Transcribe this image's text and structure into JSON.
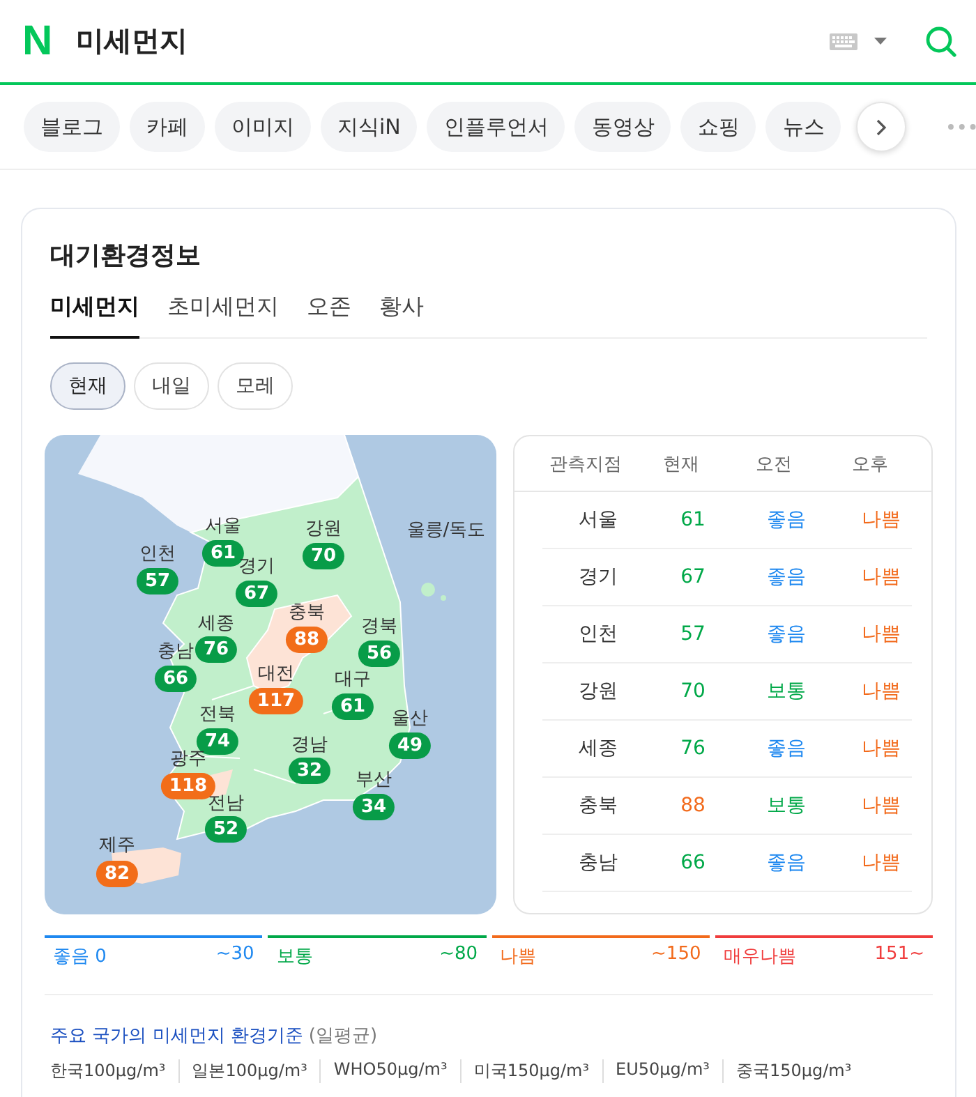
{
  "header": {
    "logo": "N",
    "query": "미세먼지"
  },
  "categories": [
    {
      "label": "블로그"
    },
    {
      "label": "카페"
    },
    {
      "label": "이미지"
    },
    {
      "label": "지식iN"
    },
    {
      "label": "인플루언서"
    },
    {
      "label": "동영상"
    },
    {
      "label": "쇼핑"
    },
    {
      "label": "뉴스"
    }
  ],
  "card": {
    "title": "대기환경정보",
    "tabs": [
      {
        "label": "미세먼지",
        "selected": true
      },
      {
        "label": "초미세먼지",
        "selected": false
      },
      {
        "label": "오존",
        "selected": false
      },
      {
        "label": "황사",
        "selected": false
      }
    ],
    "days": [
      {
        "label": "현재",
        "selected": true
      },
      {
        "label": "내일",
        "selected": false
      },
      {
        "label": "모레",
        "selected": false
      }
    ],
    "map": {
      "extra_label": "울릉/독도",
      "regions": [
        {
          "name": "서울",
          "value": "61",
          "color": "#089c48"
        },
        {
          "name": "인천",
          "value": "57",
          "color": "#089c48"
        },
        {
          "name": "강원",
          "value": "70",
          "color": "#089c48"
        },
        {
          "name": "경기",
          "value": "67",
          "color": "#089c48"
        },
        {
          "name": "충북",
          "value": "88",
          "color": "#f26d19"
        },
        {
          "name": "세종",
          "value": "76",
          "color": "#089c48"
        },
        {
          "name": "경북",
          "value": "56",
          "color": "#089c48"
        },
        {
          "name": "충남",
          "value": "66",
          "color": "#089c48"
        },
        {
          "name": "대전",
          "value": "117",
          "color": "#f26d19"
        },
        {
          "name": "대구",
          "value": "61",
          "color": "#089c48"
        },
        {
          "name": "전북",
          "value": "74",
          "color": "#089c48"
        },
        {
          "name": "울산",
          "value": "49",
          "color": "#089c48"
        },
        {
          "name": "경남",
          "value": "32",
          "color": "#089c48"
        },
        {
          "name": "광주",
          "value": "118",
          "color": "#f26d19"
        },
        {
          "name": "부산",
          "value": "34",
          "color": "#089c48"
        },
        {
          "name": "전남",
          "value": "52",
          "color": "#089c48"
        },
        {
          "name": "제주",
          "value": "82",
          "color": "#f26d19"
        }
      ]
    },
    "table": {
      "columns": [
        "관측지점",
        "현재",
        "오전",
        "오후"
      ],
      "rows": [
        {
          "site": "서울",
          "now": {
            "text": "61",
            "color": "#00a848"
          },
          "am": {
            "text": "좋음",
            "color": "#1e88f0"
          },
          "pm": {
            "text": "나쁨",
            "color": "#f26a1b"
          }
        },
        {
          "site": "경기",
          "now": {
            "text": "67",
            "color": "#00a848"
          },
          "am": {
            "text": "좋음",
            "color": "#1e88f0"
          },
          "pm": {
            "text": "나쁨",
            "color": "#f26a1b"
          }
        },
        {
          "site": "인천",
          "now": {
            "text": "57",
            "color": "#00a848"
          },
          "am": {
            "text": "좋음",
            "color": "#1e88f0"
          },
          "pm": {
            "text": "나쁨",
            "color": "#f26a1b"
          }
        },
        {
          "site": "강원",
          "now": {
            "text": "70",
            "color": "#00a848"
          },
          "am": {
            "text": "보통",
            "color": "#00a848"
          },
          "pm": {
            "text": "나쁨",
            "color": "#f26a1b"
          }
        },
        {
          "site": "세종",
          "now": {
            "text": "76",
            "color": "#00a848"
          },
          "am": {
            "text": "좋음",
            "color": "#1e88f0"
          },
          "pm": {
            "text": "나쁨",
            "color": "#f26a1b"
          }
        },
        {
          "site": "충북",
          "now": {
            "text": "88",
            "color": "#f26a1b"
          },
          "am": {
            "text": "보통",
            "color": "#00a848"
          },
          "pm": {
            "text": "나쁨",
            "color": "#f26a1b"
          }
        },
        {
          "site": "충남",
          "now": {
            "text": "66",
            "color": "#00a848"
          },
          "am": {
            "text": "좋음",
            "color": "#1e88f0"
          },
          "pm": {
            "text": "나쁨",
            "color": "#f26a1b"
          }
        }
      ]
    },
    "legend": [
      {
        "label": "좋음 0",
        "range": "~30",
        "color": "#1e88f0"
      },
      {
        "label": "보통",
        "range": "~80",
        "color": "#00a848"
      },
      {
        "label": "나쁨",
        "range": "~150",
        "color": "#f26a1b"
      },
      {
        "label": "매우나쁨",
        "range": "151~",
        "color": "#f03c3c"
      }
    ],
    "standards": {
      "title": "주요 국가의 미세먼지 환경기준",
      "note": "(일평균)",
      "items": [
        "한국100μg/m³",
        "일본100μg/m³",
        "WHO50μg/m³",
        "미국150μg/m³",
        "EU50μg/m³",
        "중국150μg/m³"
      ]
    }
  }
}
